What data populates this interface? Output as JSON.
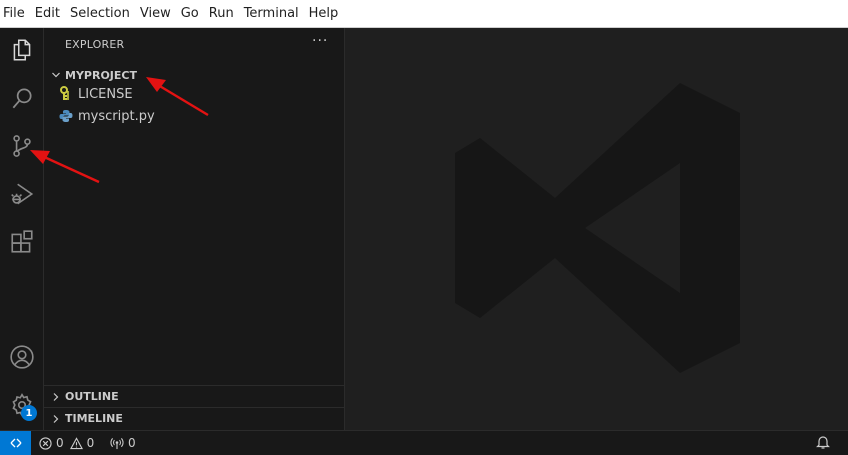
{
  "menu": [
    "File",
    "Edit",
    "Selection",
    "View",
    "Go",
    "Run",
    "Terminal",
    "Help"
  ],
  "activity_bar": {
    "items": [
      "explorer-icon",
      "search-icon",
      "source-control-icon",
      "run-debug-icon",
      "extensions-icon"
    ],
    "bottom": [
      "accounts-icon",
      "manage-gear-icon"
    ],
    "manage_badge": "1"
  },
  "sidebar": {
    "title": "EXPLORER",
    "more_label": "···",
    "folder": "MYPROJECT",
    "files": [
      {
        "name": "LICENSE",
        "icon": "license-key-icon"
      },
      {
        "name": "myscript.py",
        "icon": "python-icon"
      }
    ],
    "sections": [
      "OUTLINE",
      "TIMELINE"
    ]
  },
  "statusbar": {
    "errors": "0",
    "warnings": "0",
    "ports": "0"
  },
  "colors": {
    "accent": "#0078d4",
    "annotation_arrow": "#e31212",
    "background": "#1f1f1f",
    "sidebar": "#181818"
  }
}
